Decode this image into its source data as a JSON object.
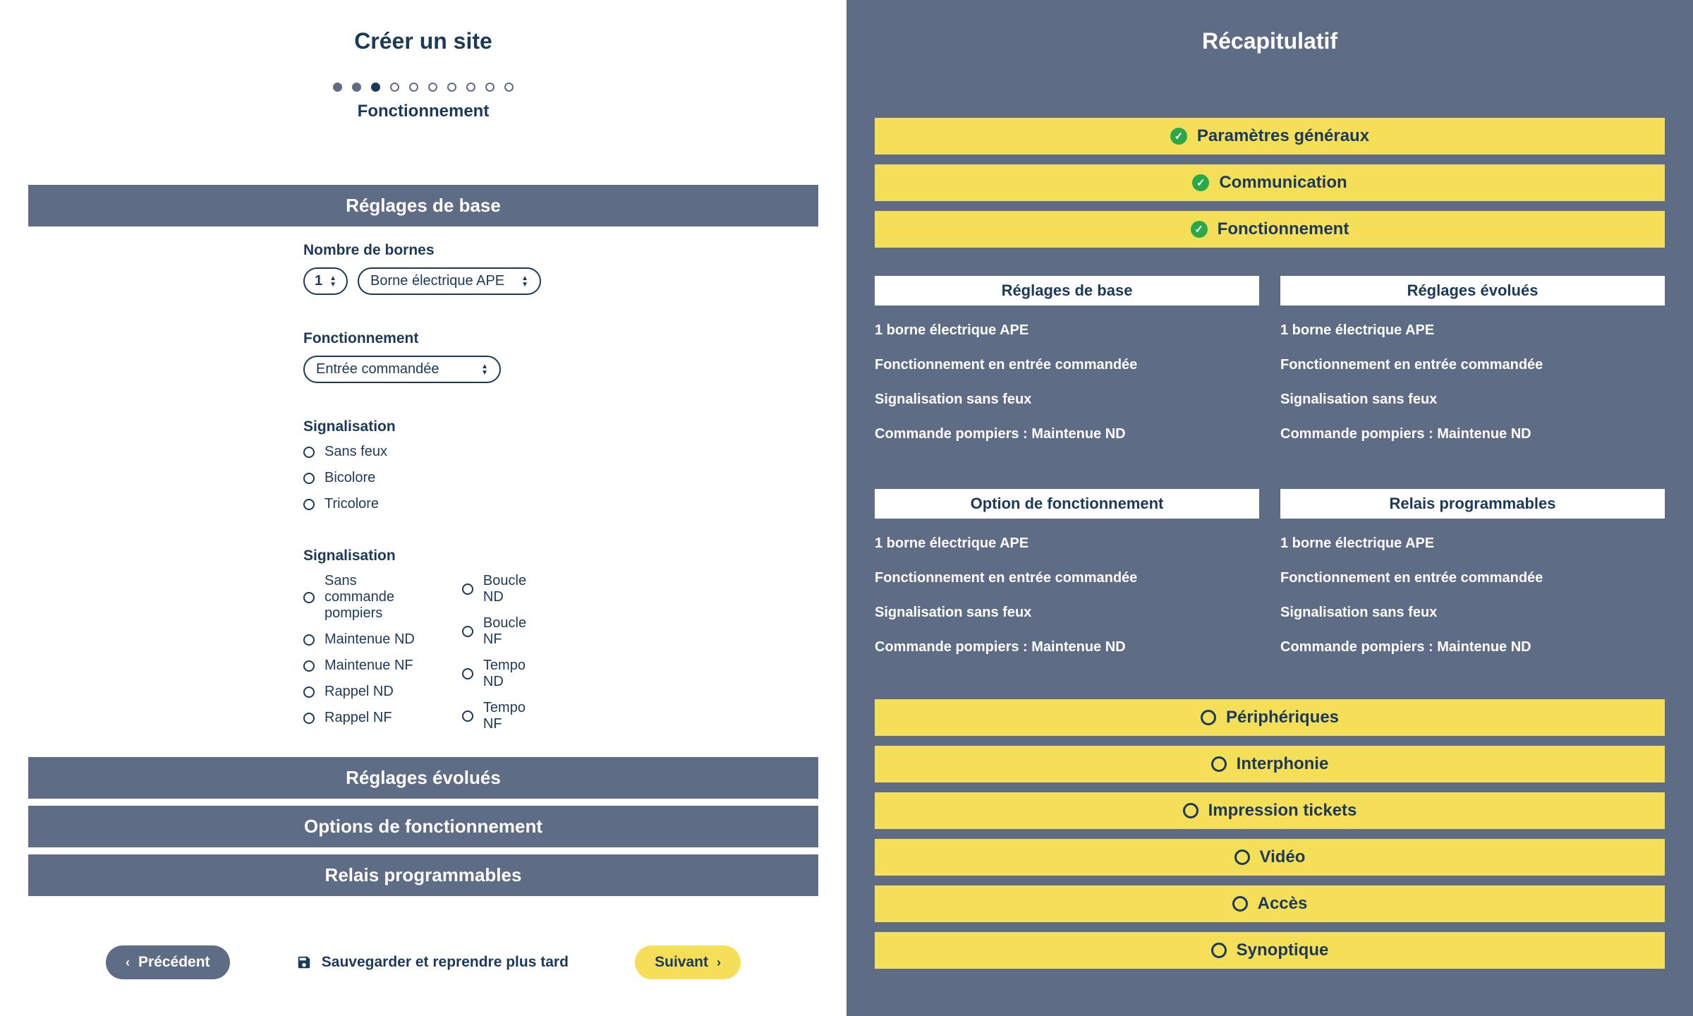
{
  "left": {
    "title": "Créer un site",
    "step_label": "Fonctionnement",
    "steps": {
      "total": 10,
      "filled": 2,
      "current_index": 2
    },
    "sections": {
      "base": "Réglages de base",
      "evolues": "Réglages évolués",
      "options": "Options de fonctionnement",
      "relais": "Relais programmables"
    },
    "fields": {
      "bornes": {
        "label": "Nombre de bornes",
        "count": "1",
        "type": "Borne électrique APE"
      },
      "fonctionnement": {
        "label": "Fonctionnement",
        "value": "Entrée commandée"
      },
      "signalisation1": {
        "label": "Signalisation",
        "options": [
          "Sans feux",
          "Bicolore",
          "Tricolore"
        ]
      },
      "signalisation2": {
        "label": "Signalisation",
        "col1": [
          "Sans commande pompiers",
          "Maintenue ND",
          "Maintenue NF",
          "Rappel ND",
          "Rappel NF"
        ],
        "col2": [
          "Boucle ND",
          "Boucle NF",
          "Tempo ND",
          "Tempo NF"
        ]
      }
    },
    "buttons": {
      "prev": "Précédent",
      "save": "Sauvegarder et reprendre plus tard",
      "next": "Suivant"
    }
  },
  "right": {
    "title": "Récapitulatif",
    "completed": [
      "Paramètres généraux",
      "Communication",
      "Fonctionnement"
    ],
    "detail_blocks": [
      {
        "cols": [
          {
            "header": "Réglages de base",
            "items": [
              "1 borne électrique APE",
              "Fonctionnement en entrée commandée",
              "Signalisation sans feux",
              "Commande pompiers : Maintenue ND"
            ]
          },
          {
            "header": "Réglages évolués",
            "items": [
              "1 borne électrique APE",
              "Fonctionnement en entrée commandée",
              "Signalisation sans feux",
              "Commande pompiers : Maintenue ND"
            ]
          }
        ]
      },
      {
        "cols": [
          {
            "header": "Option de fonctionnement",
            "items": [
              "1 borne électrique APE",
              "Fonctionnement en entrée commandée",
              "Signalisation sans feux",
              "Commande pompiers : Maintenue ND"
            ]
          },
          {
            "header": "Relais programmables",
            "items": [
              "1 borne électrique APE",
              "Fonctionnement en entrée commandée",
              "Signalisation sans feux",
              "Commande pompiers : Maintenue ND"
            ]
          }
        ]
      }
    ],
    "incomplete": [
      "Périphériques",
      "Interphonie",
      "Impression tickets",
      "Vidéo",
      "Accès",
      "Synoptique"
    ]
  }
}
